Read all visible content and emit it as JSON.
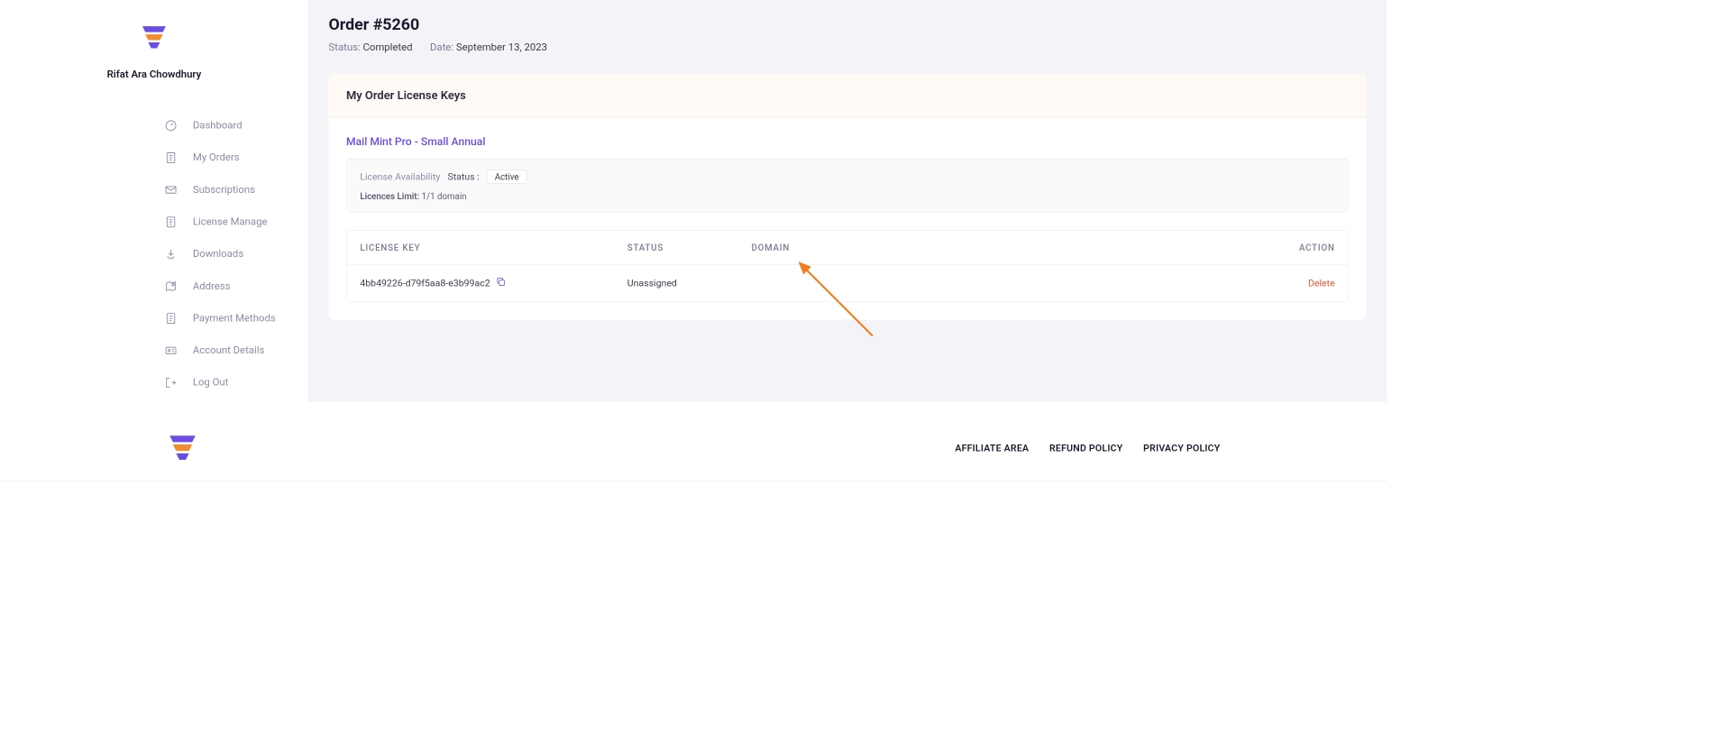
{
  "user": {
    "name": "Rifat Ara Chowdhury"
  },
  "sidebar": {
    "items": [
      {
        "label": "Dashboard"
      },
      {
        "label": "My Orders"
      },
      {
        "label": "Subscriptions"
      },
      {
        "label": "License Manage"
      },
      {
        "label": "Downloads"
      },
      {
        "label": "Address"
      },
      {
        "label": "Payment Methods"
      },
      {
        "label": "Account Details"
      },
      {
        "label": "Log Out"
      }
    ]
  },
  "order": {
    "title": "Order #5260",
    "status_label": "Status:",
    "status_value": "Completed",
    "date_label": "Date:",
    "date_value": "September 13, 2023"
  },
  "card": {
    "header": "My Order License Keys",
    "product": "Mail Mint Pro - Small Annual",
    "availability_label": "License Availability",
    "status_label": "Status :",
    "status_value": "Active",
    "limit_label": "Licences Limit:",
    "limit_value": "1/1 domain"
  },
  "table": {
    "headers": {
      "key": "LICENSE KEY",
      "status": "STATUS",
      "domain": "DOMAIN",
      "action": "ACTION"
    },
    "row": {
      "key": "4bb49226-d79f5aa8-e3b99ac2",
      "status": "Unassigned",
      "domain": "",
      "action": "Delete"
    }
  },
  "footer": {
    "links": [
      {
        "label": "AFFILIATE AREA"
      },
      {
        "label": "REFUND POLICY"
      },
      {
        "label": "PRIVACY POLICY"
      }
    ]
  }
}
